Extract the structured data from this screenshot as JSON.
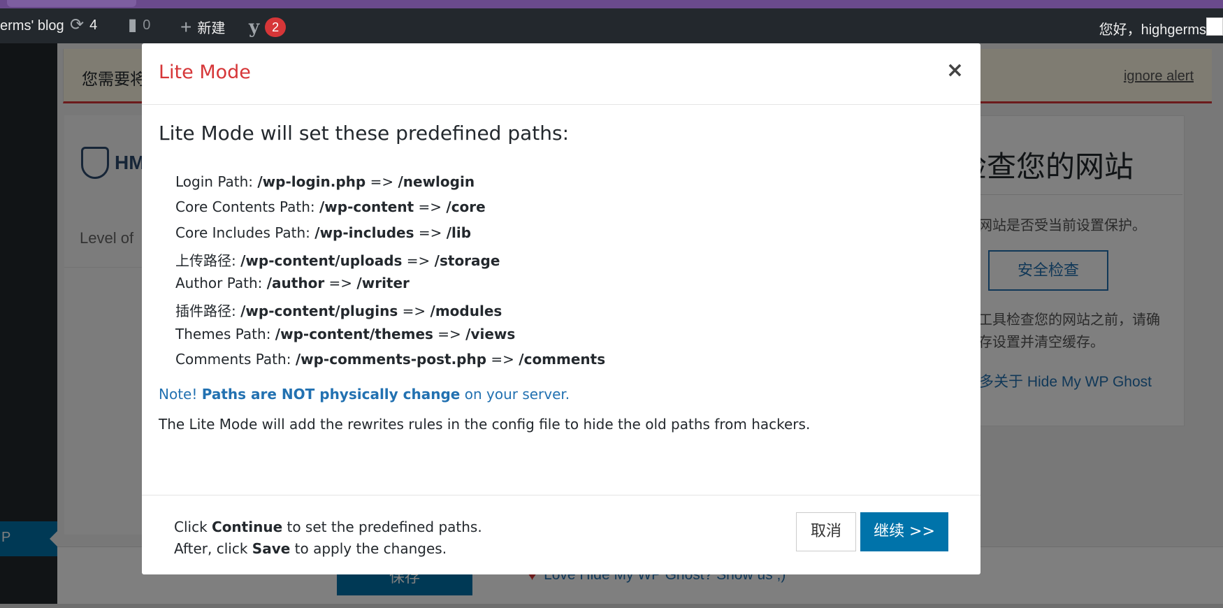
{
  "adminbar": {
    "site_name": "erms' blog",
    "updates_count": "4",
    "comments_count": "0",
    "new_label": "新建",
    "yoast_badge": "2",
    "greeting": "您好，highgerms"
  },
  "menu": {
    "current_label": "P"
  },
  "background": {
    "notice_text": "您需要将",
    "ignore_alert": "ignore alert",
    "brand_short": "HM",
    "level_label": "Level of",
    "right_title": "检查您的网站",
    "right_line1": "的网站是否受当前设置保护。",
    "security_check_button": "安全检查",
    "right_line2a": "的工具检查您的网站之前，请确",
    "right_line2b": "保存设置并清空缓存。",
    "right_link": "更多关于 Hide My WP Ghost",
    "save_button": "保存",
    "love_text": "Love Hide My WP Ghost? Show us ;)"
  },
  "modal": {
    "title": "Lite Mode",
    "close_symbol": "×",
    "heading": "Lite Mode will set these predefined paths:",
    "paths": [
      {
        "label": "Login Path:",
        "old": "/wp-login.php",
        "arrow": "=>",
        "new": "/newlogin"
      },
      {
        "label": "Core Contents Path:",
        "old": "/wp-content",
        "arrow": "=>",
        "new": "/core"
      },
      {
        "label": "Core Includes Path:",
        "old": "/wp-includes",
        "arrow": "=>",
        "new": "/lib"
      },
      {
        "label": "上传路径:",
        "old": "/wp-content/uploads",
        "arrow": "=>",
        "new": "/storage"
      },
      {
        "label": "Author Path:",
        "old": "/author",
        "arrow": "=>",
        "new": "/writer"
      },
      {
        "label": "插件路径:",
        "old": "/wp-content/plugins",
        "arrow": "=>",
        "new": "/modules"
      },
      {
        "label": "Themes Path:",
        "old": "/wp-content/themes",
        "arrow": "=>",
        "new": "/views"
      },
      {
        "label": "Comments Path:",
        "old": "/wp-comments-post.php",
        "arrow": "=>",
        "new": "/comments"
      }
    ],
    "note_prefix": "Note!",
    "note_bold": "Paths are NOT physically change",
    "note_suffix": "on your server.",
    "description": "The Lite Mode will add the rewrites rules in the config file to hide the old paths from hackers.",
    "footer_line1_pre": "Click",
    "footer_line1_bold": "Continue",
    "footer_line1_post": "to set the predefined paths.",
    "footer_line2_pre": "After, click",
    "footer_line2_bold": "Save",
    "footer_line2_post": "to apply the changes.",
    "cancel_button": "取消",
    "continue_button": "继续 >>"
  },
  "colors": {
    "admin_bar": "#23282d",
    "primary": "#0073aa",
    "modal_title": "#d63638",
    "link": "#2271b1"
  }
}
